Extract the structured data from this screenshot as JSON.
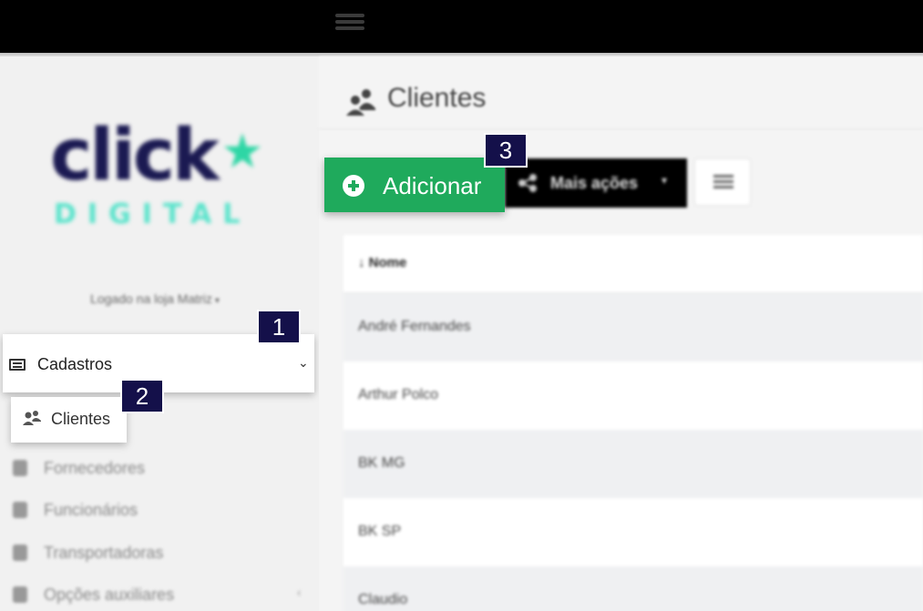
{
  "sidebar": {
    "logo": {
      "word": "click",
      "subword": "DIGITAL"
    },
    "loja": {
      "text": "Logado na loja Matriz",
      "caret": "▾"
    },
    "menu": {
      "cadastros": {
        "label": "Cadastros",
        "chevron": "⌄",
        "icon": "list-icon"
      },
      "clientes": {
        "label": "Clientes",
        "icon": "users-icon"
      },
      "items": [
        {
          "label": "Fornecedores",
          "icon": "clipboard-icon"
        },
        {
          "label": "Funcionários",
          "icon": "badge-icon"
        },
        {
          "label": "Transportadoras",
          "icon": "truck-icon"
        },
        {
          "label": "Opções auxiliares",
          "icon": "files-icon",
          "arrow": "‹"
        }
      ]
    }
  },
  "main": {
    "title": "Clientes",
    "toolbar": {
      "add_label": "Adicionar",
      "more_label": "Mais ações",
      "more_caret": "▾"
    },
    "table": {
      "header": "↓ Nome",
      "rows": [
        "André Fernandes",
        "Arthur Polco",
        "BK MG",
        "BK SP",
        "Claudio"
      ]
    }
  },
  "callouts": [
    "1",
    "2",
    "3"
  ],
  "colors": {
    "accent_green": "#1faa5c",
    "brand_navy": "#1b1a52",
    "brand_teal": "#34e0c2",
    "callout_bg": "#14104a"
  }
}
